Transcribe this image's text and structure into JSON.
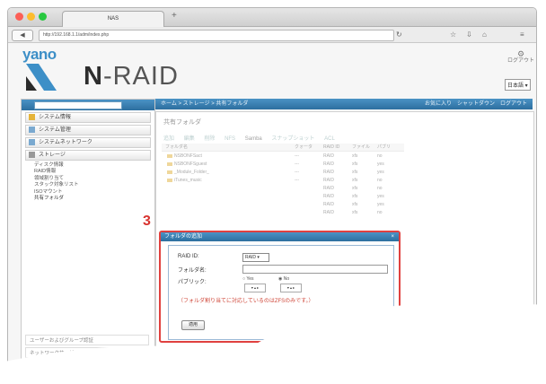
{
  "browser": {
    "tab_title": "NAS",
    "new_tab": "+",
    "url": "http://192.168.1.1/adm/index.php",
    "back": "◀",
    "fwd": "▶",
    "icons": [
      "refresh-icon",
      "star-icon",
      "download-icon",
      "home-icon",
      "menu-icon"
    ]
  },
  "header": {
    "brand_small": "yano",
    "brand_prefix": "N",
    "brand_suffix": "-RAID",
    "logout": "ログアウト",
    "language": "日本語"
  },
  "breadcrumb": {
    "path": "ホーム > ストレージ > 共有フォルダ",
    "links": "お気に入り　シャットダウン　ログアウト"
  },
  "sidebar": {
    "items": [
      {
        "label": "システム情報"
      },
      {
        "label": "システム管理"
      },
      {
        "label": "システムネットワーク"
      },
      {
        "label": "ストレージ"
      }
    ],
    "subitems": [
      {
        "label": "ディスク情報"
      },
      {
        "label": "RAID情報"
      },
      {
        "label": "領域割り当て"
      },
      {
        "label": "スタック対象リスト"
      },
      {
        "label": "ISOマウント"
      },
      {
        "label": "共有フォルダ"
      }
    ],
    "bottom_items": [
      {
        "label": "ユーザーおよびグループ認証"
      },
      {
        "label": "ネットワークサービス"
      }
    ]
  },
  "main": {
    "title": "共有フォルダ",
    "actions": [
      "追加",
      "編集",
      "削除",
      "NFS",
      "Samba",
      "スナップショット",
      "ACL"
    ],
    "columns": [
      "フォルダ名",
      "クォータ",
      "RAID ID",
      "ファイル",
      "パブリ"
    ],
    "rows": [
      {
        "name": "NSBONFSact",
        "quota": "---",
        "raid": "RAID",
        "fs": "xfs",
        "pub": "no"
      },
      {
        "name": "NSBONFSguest",
        "quota": "---",
        "raid": "RAID",
        "fs": "xfs",
        "pub": "yes"
      },
      {
        "name": "_Module_Folder_",
        "quota": "---",
        "raid": "RAID",
        "fs": "xfs",
        "pub": "yes"
      },
      {
        "name": "iTunes_music",
        "quota": "---",
        "raid": "RAID",
        "fs": "xfs",
        "pub": "no"
      }
    ],
    "extra_rows": [
      {
        "raid": "RAID",
        "fs": "xfs",
        "pub": "no"
      },
      {
        "raid": "RAID",
        "fs": "xfs",
        "pub": "yes"
      },
      {
        "raid": "RAID",
        "fs": "xfs",
        "pub": "yes"
      },
      {
        "raid": "RAID",
        "fs": "xfs",
        "pub": "no"
      }
    ]
  },
  "dialog": {
    "step_number": "3",
    "title": "フォルダの追加",
    "raid_label": "RAID ID:",
    "raid_value": "RAID",
    "folder_label": "フォルダ名:",
    "folder_value": "",
    "public_label": "パブリック:",
    "public_yes": "Yes",
    "public_no": "No",
    "note": "（フォルダ割り当てに対応しているのはZFSのみです。）",
    "apply": "適用"
  },
  "colors": {
    "accent_blue": "#3d8fc7",
    "highlight_red": "#e0413f"
  }
}
